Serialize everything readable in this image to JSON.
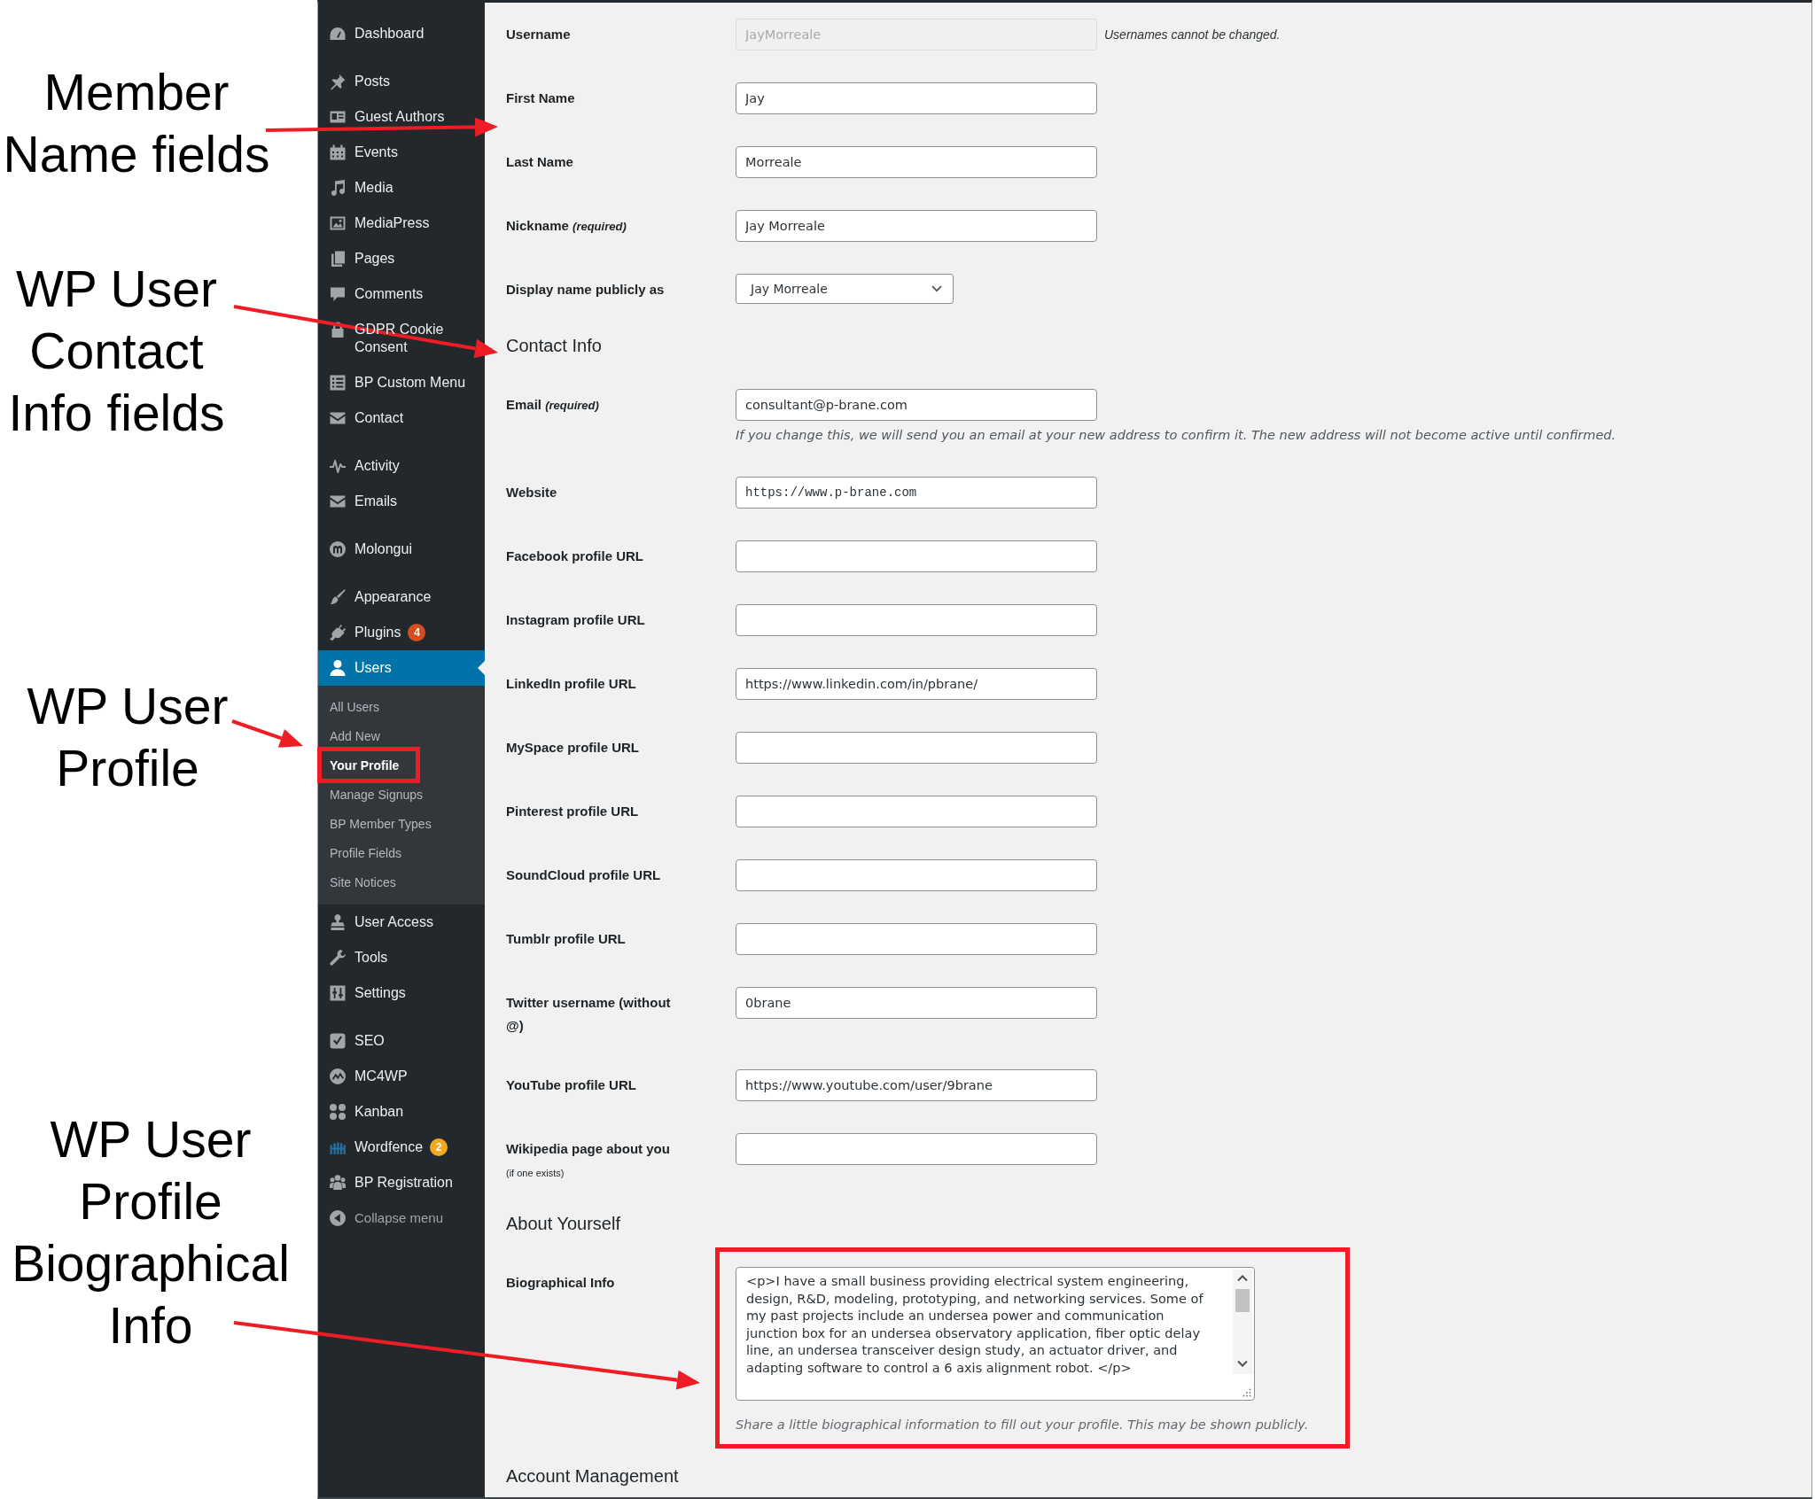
{
  "callouts": [
    {
      "text": "Member\nName fields"
    },
    {
      "text": "WP User\nContact\nInfo fields"
    },
    {
      "text": "WP User\nProfile"
    },
    {
      "text": "WP User\nProfile\nBiographical\nInfo"
    }
  ],
  "sidebar": {
    "groups": [
      {
        "items": [
          {
            "label": "Dashboard",
            "selected": false
          }
        ]
      },
      {
        "items": [
          {
            "label": "Posts",
            "selected": false
          },
          {
            "label": "Guest Authors",
            "selected": false
          },
          {
            "label": "Events",
            "selected": false
          },
          {
            "label": "Media",
            "selected": false
          },
          {
            "label": "MediaPress",
            "selected": false
          },
          {
            "label": "Pages",
            "selected": false
          },
          {
            "label": "Comments",
            "selected": false
          },
          {
            "label": "GDPR Cookie Consent",
            "selected": false
          },
          {
            "label": "BP Custom Menu",
            "selected": false
          },
          {
            "label": "Contact",
            "selected": false
          }
        ]
      },
      {
        "items": [
          {
            "label": "Activity",
            "selected": false
          },
          {
            "label": "Emails",
            "selected": false
          }
        ]
      },
      {
        "items": [
          {
            "label": "Molongui",
            "selected": false
          }
        ]
      },
      {
        "items": [
          {
            "label": "Appearance",
            "selected": false
          },
          {
            "label": "Plugins",
            "selected": false,
            "badge": {
              "text": "4",
              "color": "#d54e21"
            }
          },
          {
            "label": "Users",
            "selected": true,
            "submenu": [
              {
                "label": "All Users",
                "selected": false,
                "highlighted": false
              },
              {
                "label": "Add New",
                "selected": false,
                "highlighted": false
              },
              {
                "label": "Your Profile",
                "selected": true,
                "highlighted": true
              },
              {
                "label": "Manage Signups",
                "selected": false,
                "highlighted": false
              },
              {
                "label": "BP Member Types",
                "selected": false,
                "highlighted": false
              },
              {
                "label": "Profile Fields",
                "selected": false,
                "highlighted": false
              },
              {
                "label": "Site Notices",
                "selected": false,
                "highlighted": false
              }
            ]
          },
          {
            "label": "User Access",
            "selected": false
          },
          {
            "label": "Tools",
            "selected": false
          },
          {
            "label": "Settings",
            "selected": false
          }
        ]
      },
      {
        "items": [
          {
            "label": "SEO",
            "selected": false
          },
          {
            "label": "MC4WP",
            "selected": false
          },
          {
            "label": "Kanban",
            "selected": false
          },
          {
            "label": "Wordfence",
            "selected": false,
            "badge": {
              "text": "2",
              "color": "#f0a81e"
            }
          },
          {
            "label": "BP Registration",
            "selected": false
          }
        ]
      }
    ],
    "collapse_label": "Collapse menu"
  },
  "profile_form": {
    "sections": [
      {
        "rows": [
          {
            "kind": "text",
            "label": "Username",
            "value": "JayMorreale",
            "note": "Usernames cannot be changed.",
            "disabled": true,
            "highlighted": false
          },
          {
            "kind": "text",
            "label": "First Name",
            "value": "Jay",
            "disabled": false,
            "highlighted": false
          },
          {
            "kind": "text",
            "label": "Last Name",
            "value": "Morreale",
            "disabled": false,
            "highlighted": false
          },
          {
            "kind": "text",
            "label": "Nickname *(required)*",
            "value": "Jay Morreale",
            "disabled": false,
            "highlighted": false
          },
          {
            "kind": "select",
            "label": "Display name publicly as",
            "value": "Jay Morreale",
            "disabled": false,
            "highlighted": false
          }
        ]
      },
      {
        "heading": "Contact Info",
        "rows": [
          {
            "kind": "text",
            "label": "Email *(required)*",
            "value": "consultant@p-brane.com",
            "description": "If you change this, we will send you an email at your new address to confirm it. The new address will not become active until confirmed.",
            "disabled": false,
            "highlighted": false
          },
          {
            "kind": "code",
            "label": "Website",
            "value": "https://www.p-brane.com",
            "disabled": false,
            "highlighted": false
          },
          {
            "kind": "text",
            "label": "Facebook profile URL",
            "disabled": false,
            "highlighted": false
          },
          {
            "kind": "text",
            "label": "Instagram profile URL",
            "disabled": false,
            "highlighted": false
          },
          {
            "kind": "text",
            "label": "LinkedIn profile URL",
            "value": "https://www.linkedin.com/in/pbrane/",
            "disabled": false,
            "highlighted": false
          },
          {
            "kind": "text",
            "label": "MySpace profile URL",
            "disabled": false,
            "highlighted": false
          },
          {
            "kind": "text",
            "label": "Pinterest profile URL",
            "disabled": false,
            "highlighted": false
          },
          {
            "kind": "text",
            "label": "SoundCloud profile URL",
            "disabled": false,
            "highlighted": false
          },
          {
            "kind": "text",
            "label": "Tumblr profile URL",
            "disabled": false,
            "highlighted": false
          },
          {
            "kind": "text",
            "label": "Twitter username (without @)",
            "value": "0brane",
            "disabled": false,
            "highlighted": false
          },
          {
            "kind": "text",
            "label": "YouTube profile URL",
            "value": "https://www.youtube.com/user/9brane",
            "disabled": false,
            "highlighted": false
          },
          {
            "kind": "text",
            "label": "Wikipedia page about you",
            "sublabel": "(if one exists)",
            "disabled": false,
            "highlighted": false
          }
        ]
      },
      {
        "heading": "About Yourself",
        "rows": [
          {
            "kind": "textarea",
            "label": "Biographical Info",
            "value": "<p>I have a small business providing electrical system engineering, design, R&D, modeling, prototyping, and networking services. Some of my past projects include an undersea power and communication junction box for an undersea observatory application, fiber optic delay line, an undersea transceiver design study, an actuator driver, and adapting software to control a 6 axis alignment robot. </p>",
            "description": "Share a little biographical information to fill out your profile. This may be shown publicly.",
            "disabled": false,
            "highlighted": true
          }
        ]
      },
      {
        "heading": "Account Management"
      }
    ]
  }
}
